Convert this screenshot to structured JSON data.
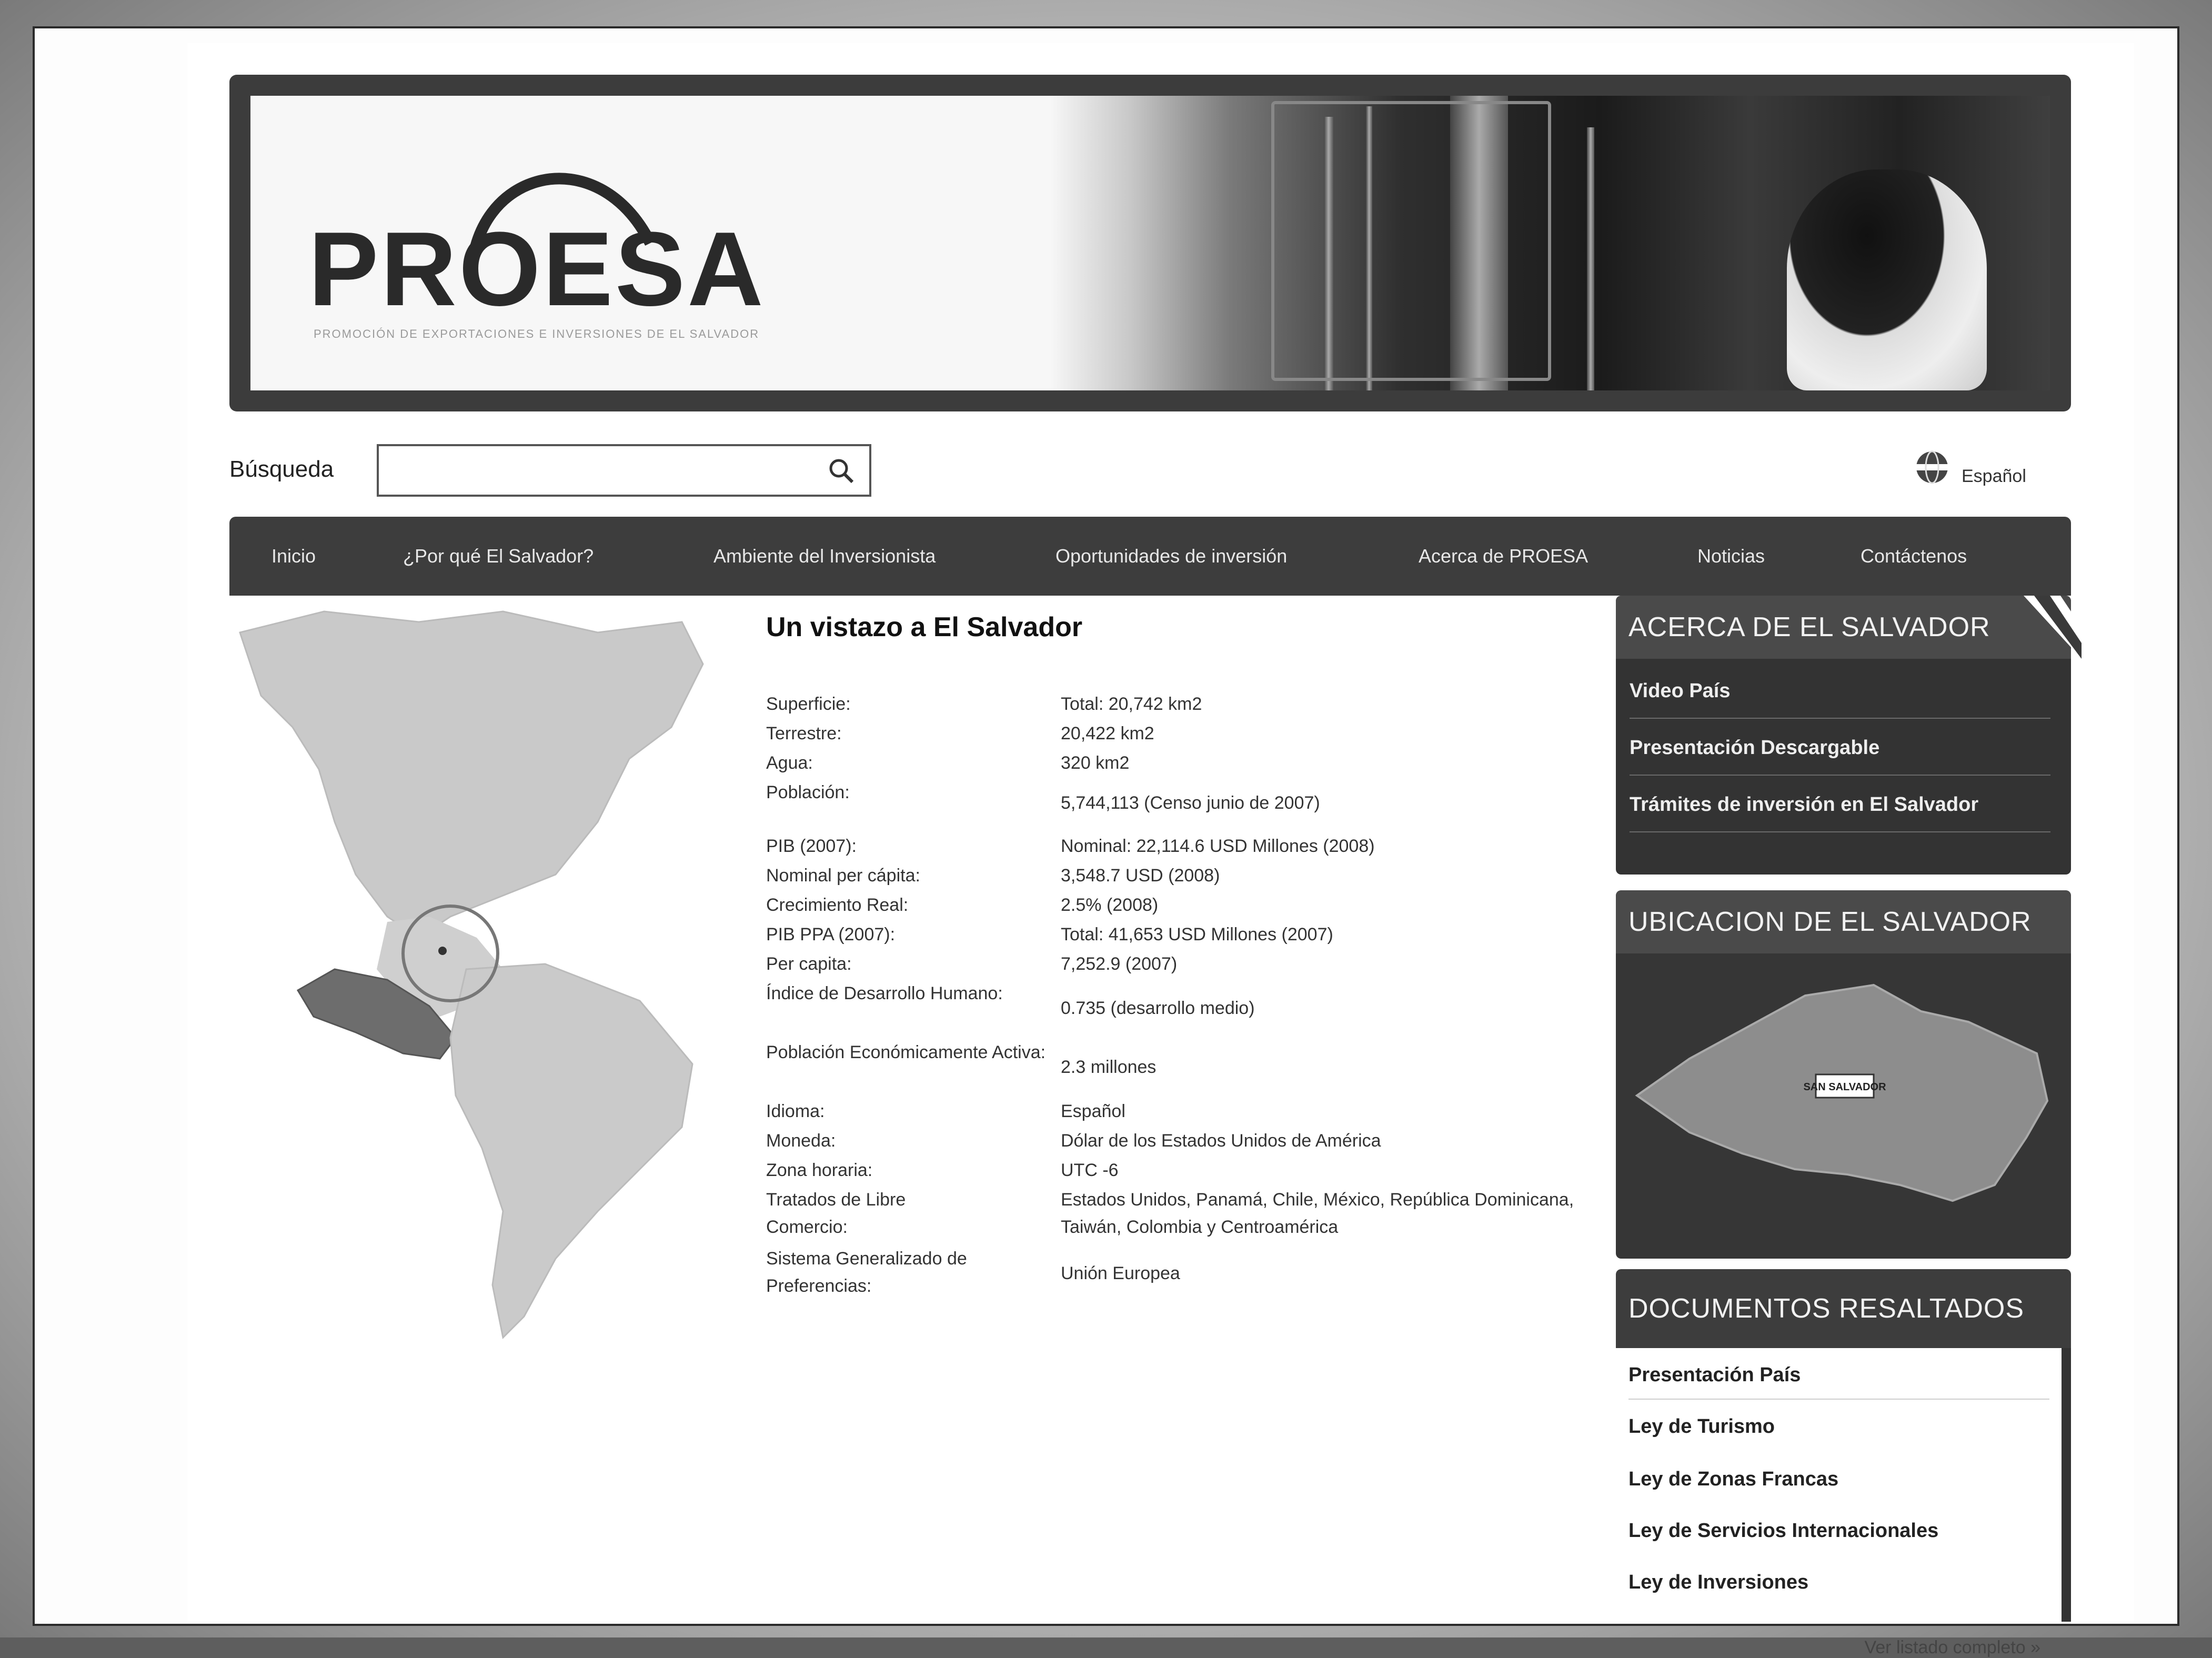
{
  "header": {
    "logo_text": "PROESA",
    "logo_tagline": "PROMOCIÓN DE EXPORTACIONES E INVERSIONES DE EL SALVADOR"
  },
  "search": {
    "label": "Búsqueda",
    "value": "",
    "placeholder": ""
  },
  "language": {
    "label": "Español"
  },
  "nav": {
    "items": [
      "Inicio",
      "¿Por qué El Salvador?",
      "Ambiente del Inversionista",
      "Oportunidades de inversión",
      "Acerca de PROESA",
      "Noticias",
      "Contáctenos"
    ]
  },
  "main": {
    "title": "Un vistazo a El Salvador",
    "rows": [
      {
        "label": "Superficie:",
        "value": "Total: 20,742 km2"
      },
      {
        "label": "Terrestre:",
        "value": "20,422 km2"
      },
      {
        "label": "Agua:",
        "value": "320 km2"
      },
      {
        "label": "Población:",
        "value": "5,744,113 (Censo junio de 2007)"
      },
      {
        "label": "PIB (2007):",
        "value": "Nominal: 22,114.6 USD Millones (2008)"
      },
      {
        "label": "Nominal per cápita:",
        "value": "3,548.7 USD (2008)"
      },
      {
        "label": "Crecimiento Real:",
        "value": "2.5% (2008)"
      },
      {
        "label": "PIB PPA (2007):",
        "value": "Total: 41,653 USD Millones (2007)"
      },
      {
        "label": "Per capita:",
        "value": "7,252.9 (2007)"
      },
      {
        "label": "Índice de Desarrollo Humano:",
        "value": "0.735 (desarrollo medio)"
      },
      {
        "label": "Población Económicamente Activa:",
        "value": "2.3 millones"
      },
      {
        "label": "Idioma:",
        "value": "Español"
      },
      {
        "label": "Moneda:",
        "value": "Dólar de los Estados Unidos de América"
      },
      {
        "label": "Zona horaria:",
        "value": "UTC -6"
      },
      {
        "label": "Tratados de Libre Comercio:",
        "value": "Estados Unidos, Panamá, Chile, México, República Dominicana, Taiwán, Colombia y Centroamérica"
      },
      {
        "label": "Sistema Generalizado de Preferencias:",
        "value": "Unión Europea"
      }
    ]
  },
  "sidebar": {
    "about": {
      "title": "ACERCA DE EL SALVADOR",
      "links": [
        "Video País",
        "Presentación Descargable",
        "Trámites de inversión en El Salvador"
      ]
    },
    "location": {
      "title": "UBICACION DE EL SALVADOR",
      "marker_label": "SAN SALVADOR"
    },
    "documents": {
      "title": "DOCUMENTOS RESALTADOS",
      "links": [
        "Presentación País",
        "Ley de Turismo",
        "Ley de Zonas Francas",
        "Ley de Servicios Internacionales",
        "Ley de Inversiones"
      ],
      "more": "Ver listado completo »"
    }
  },
  "colors": {
    "nav_bg": "#3d3d3d",
    "sidebar_bg": "#333333",
    "page_bg": "#ffffff"
  }
}
